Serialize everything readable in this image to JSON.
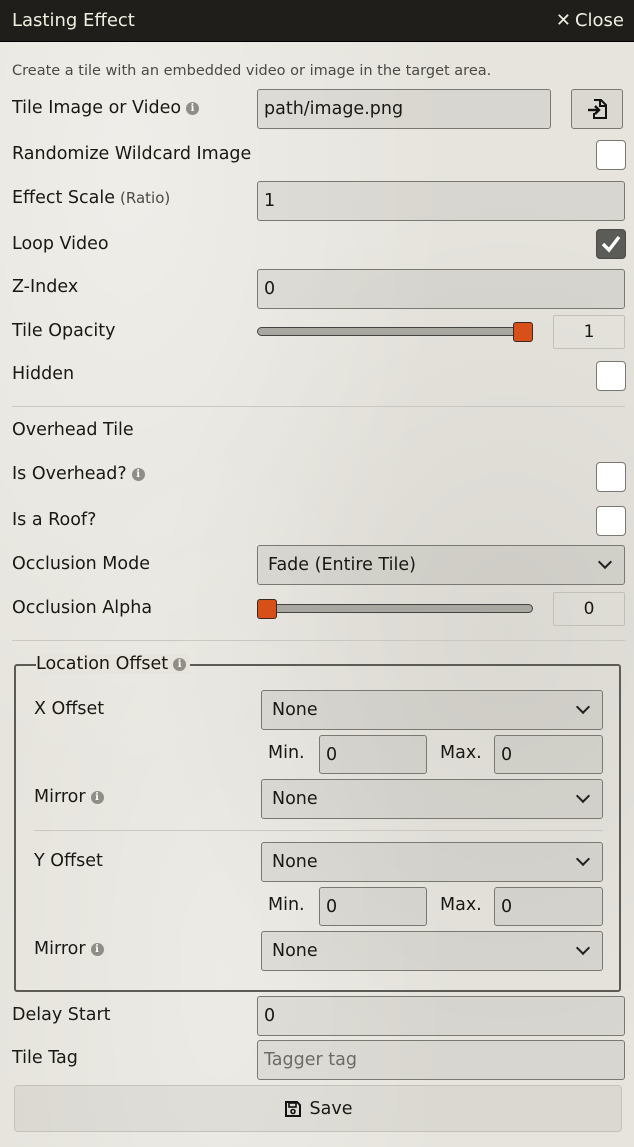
{
  "window": {
    "title": "Lasting Effect",
    "close_label": "Close"
  },
  "hint": "Create a tile with an embedded video or image in the target area.",
  "tile_image": {
    "label": "Tile Image or Video",
    "value": "path/image.png"
  },
  "randomize": {
    "label": "Randomize Wildcard Image",
    "checked": false
  },
  "effect_scale": {
    "label": "Effect Scale",
    "sub": "(Ratio)",
    "value": "1"
  },
  "loop_video": {
    "label": "Loop Video",
    "checked": true
  },
  "z_index": {
    "label": "Z-Index",
    "value": "0"
  },
  "tile_opacity": {
    "label": "Tile Opacity",
    "value": "1",
    "fraction": 1
  },
  "hidden": {
    "label": "Hidden",
    "checked": false
  },
  "overhead": {
    "heading": "Overhead Tile"
  },
  "is_overhead": {
    "label": "Is Overhead?",
    "checked": false
  },
  "is_roof": {
    "label": "Is a Roof?",
    "checked": false
  },
  "occlusion_mode": {
    "label": "Occlusion Mode",
    "value": "Fade (Entire Tile)"
  },
  "occlusion_alpha": {
    "label": "Occlusion Alpha",
    "value": "0",
    "fraction": 0
  },
  "location_offset": {
    "legend": "Location Offset",
    "x": {
      "label": "X Offset",
      "value": "None",
      "min_label": "Min.",
      "min": "0",
      "max_label": "Max.",
      "max": "0",
      "mirror_label": "Mirror",
      "mirror": "None"
    },
    "y": {
      "label": "Y Offset",
      "value": "None",
      "min_label": "Min.",
      "min": "0",
      "max_label": "Max.",
      "max": "0",
      "mirror_label": "Mirror",
      "mirror": "None"
    }
  },
  "delay_start": {
    "label": "Delay Start",
    "value": "0"
  },
  "tile_tag": {
    "label": "Tile Tag",
    "placeholder": "Tagger tag"
  },
  "save": {
    "label": "Save"
  },
  "colors": {
    "accent": "#d7501a",
    "titlebar": "#1f1e1b"
  },
  "icons": [
    "close-icon",
    "info-icon",
    "file-import-icon",
    "checkmark-icon",
    "chevron-down-icon",
    "save-icon"
  ]
}
